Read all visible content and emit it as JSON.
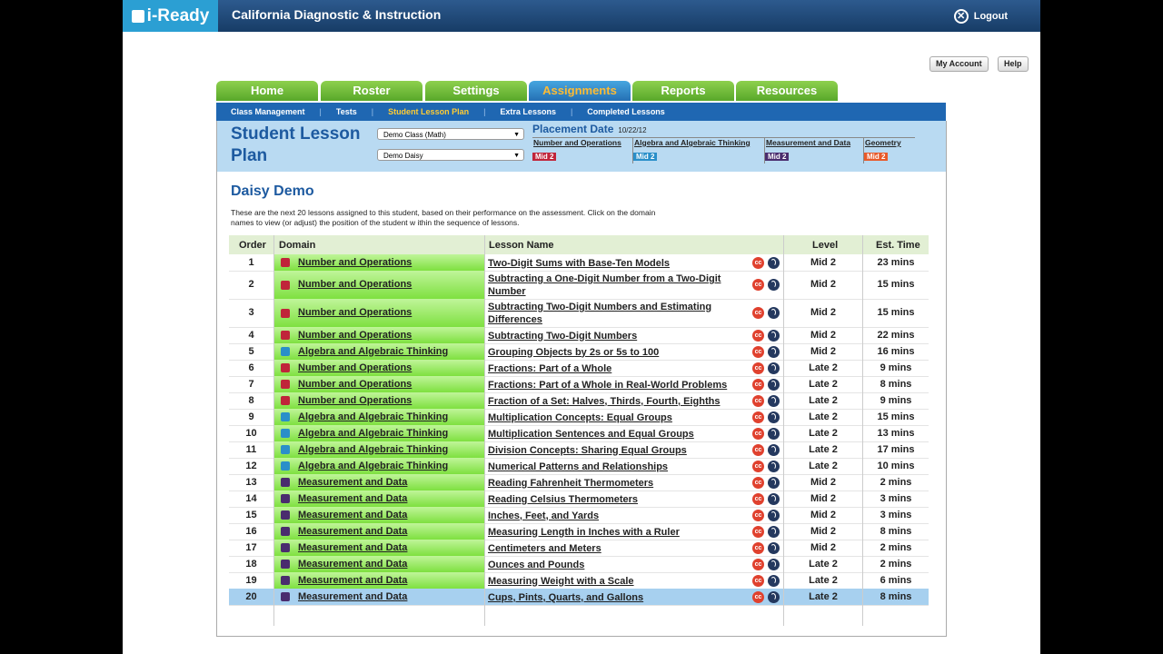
{
  "header": {
    "logo": "i-Ready",
    "app_title": "California Diagnostic & Instruction",
    "logout": "Logout",
    "my_account": "My Account",
    "help": "Help"
  },
  "tabs": [
    "Home",
    "Roster",
    "Settings",
    "Assignments",
    "Reports",
    "Resources"
  ],
  "active_tab": "Assignments",
  "subnav": [
    "Class Management",
    "Tests",
    "Student Lesson Plan",
    "Extra Lessons",
    "Completed Lessons"
  ],
  "active_subnav": "Student Lesson Plan",
  "plan": {
    "title": "Student Lesson Plan",
    "class_select": "Demo Class (Math)",
    "student_select": "Demo Daisy",
    "placement_label": "Placement Date",
    "placement_date": "10/22/12",
    "domains": [
      {
        "name": "Number and Operations",
        "level": "Mid 2",
        "color": "#c0243a"
      },
      {
        "name": "Algebra and Algebraic Thinking",
        "level": "Mid 2",
        "color": "#2a8fc9"
      },
      {
        "name": "Measurement and Data",
        "level": "Mid 2",
        "color": "#4a2c6e"
      },
      {
        "name": "Geometry",
        "level": "Mid 2",
        "color": "#e85a2a"
      }
    ]
  },
  "student_name": "Daisy Demo",
  "description": "These are the next 20 lessons assigned to this student, based on their performance on the assessment. Click on the domain names to view  (or adjust) the position of the student w ithin the sequence of lessons.",
  "table": {
    "headers": {
      "order": "Order",
      "domain": "Domain",
      "lesson": "Lesson Name",
      "level": "Level",
      "time": "Est. Time"
    },
    "icon_cc": "cc",
    "rows": [
      {
        "order": "1",
        "domain": "Number and Operations",
        "dcolor": "#c0243a",
        "lesson": "Two-Digit Sums with Base-Ten Models",
        "level": "Mid 2",
        "time": "23 mins"
      },
      {
        "order": "2",
        "domain": "Number and Operations",
        "dcolor": "#c0243a",
        "lesson": "Subtracting a One-Digit Number from a Two-Digit Number",
        "level": "Mid 2",
        "time": "15 mins"
      },
      {
        "order": "3",
        "domain": "Number and Operations",
        "dcolor": "#c0243a",
        "lesson": "Subtracting Two-Digit Numbers and Estimating Differences",
        "level": "Mid 2",
        "time": "15 mins"
      },
      {
        "order": "4",
        "domain": "Number and Operations",
        "dcolor": "#c0243a",
        "lesson": "Subtracting Two-Digit Numbers",
        "level": "Mid 2",
        "time": "22 mins"
      },
      {
        "order": "5",
        "domain": "Algebra and Algebraic Thinking",
        "dcolor": "#2a8fc9",
        "lesson": "Grouping Objects by 2s or 5s to 100",
        "level": "Mid 2",
        "time": "16 mins"
      },
      {
        "order": "6",
        "domain": "Number and Operations",
        "dcolor": "#c0243a",
        "lesson": "Fractions: Part of a Whole",
        "level": "Late 2",
        "time": "9 mins"
      },
      {
        "order": "7",
        "domain": "Number and Operations",
        "dcolor": "#c0243a",
        "lesson": "Fractions: Part of a Whole in Real-World Problems",
        "level": "Late 2",
        "time": "8 mins"
      },
      {
        "order": "8",
        "domain": "Number and Operations",
        "dcolor": "#c0243a",
        "lesson": "Fraction of a Set: Halves, Thirds, Fourth, Eighths",
        "level": "Late 2",
        "time": "9 mins"
      },
      {
        "order": "9",
        "domain": "Algebra and Algebraic Thinking",
        "dcolor": "#2a8fc9",
        "lesson": "Multiplication Concepts: Equal Groups",
        "level": "Late 2",
        "time": "15 mins"
      },
      {
        "order": "10",
        "domain": "Algebra and Algebraic Thinking",
        "dcolor": "#2a8fc9",
        "lesson": "Multiplication Sentences and Equal Groups",
        "level": "Late 2",
        "time": "13 mins"
      },
      {
        "order": "11",
        "domain": "Algebra and Algebraic Thinking",
        "dcolor": "#2a8fc9",
        "lesson": "Division Concepts: Sharing Equal Groups",
        "level": "Late 2",
        "time": "17 mins"
      },
      {
        "order": "12",
        "domain": "Algebra and Algebraic Thinking",
        "dcolor": "#2a8fc9",
        "lesson": "Numerical Patterns and Relationships",
        "level": "Late 2",
        "time": "10 mins"
      },
      {
        "order": "13",
        "domain": "Measurement and Data",
        "dcolor": "#4a2c6e",
        "lesson": "Reading Fahrenheit Thermometers",
        "level": "Mid 2",
        "time": "2 mins"
      },
      {
        "order": "14",
        "domain": "Measurement and Data",
        "dcolor": "#4a2c6e",
        "lesson": "Reading Celsius Thermometers",
        "level": "Mid 2",
        "time": "3 mins"
      },
      {
        "order": "15",
        "domain": "Measurement and Data",
        "dcolor": "#4a2c6e",
        "lesson": "Inches, Feet, and Yards",
        "level": "Mid 2",
        "time": "3 mins"
      },
      {
        "order": "16",
        "domain": "Measurement and Data",
        "dcolor": "#4a2c6e",
        "lesson": "Measuring Length in Inches with a Ruler",
        "level": "Mid 2",
        "time": "8 mins"
      },
      {
        "order": "17",
        "domain": "Measurement and Data",
        "dcolor": "#4a2c6e",
        "lesson": "Centimeters and Meters",
        "level": "Mid 2",
        "time": "2 mins"
      },
      {
        "order": "18",
        "domain": "Measurement and Data",
        "dcolor": "#4a2c6e",
        "lesson": "Ounces and Pounds",
        "level": "Late 2",
        "time": "2 mins"
      },
      {
        "order": "19",
        "domain": "Measurement and Data",
        "dcolor": "#4a2c6e",
        "lesson": "Measuring Weight with a Scale",
        "level": "Late 2",
        "time": "6 mins"
      },
      {
        "order": "20",
        "domain": "Measurement and Data",
        "dcolor": "#4a2c6e",
        "lesson": "Cups, Pints, Quarts, and Gallons",
        "level": "Late 2",
        "time": "8 mins",
        "selected": true
      }
    ]
  }
}
